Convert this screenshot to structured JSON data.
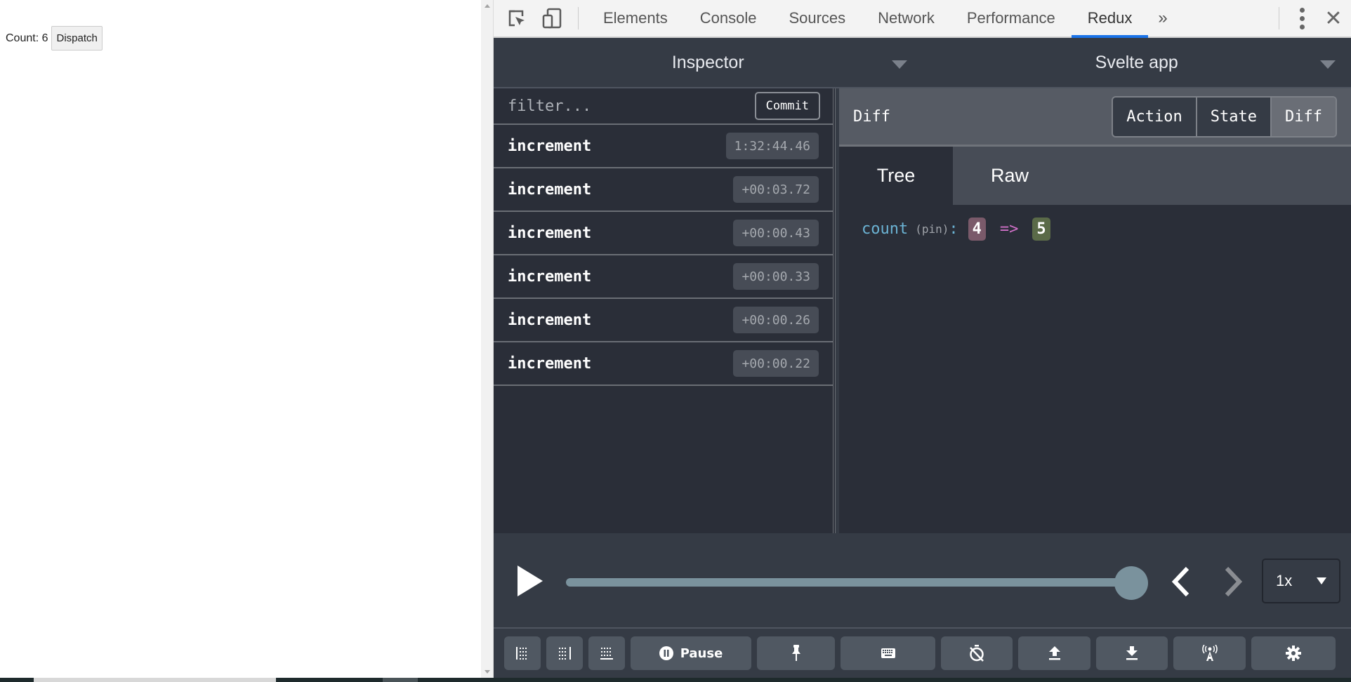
{
  "page": {
    "count_label": "Count: 6",
    "dispatch_label": "Dispatch"
  },
  "devtools": {
    "toolbar": {
      "inspect_icon": "inspect-element-icon",
      "device_icon": "device-toolbar-icon",
      "tabs": [
        {
          "label": "Elements",
          "active": false
        },
        {
          "label": "Console",
          "active": false
        },
        {
          "label": "Sources",
          "active": false
        },
        {
          "label": "Network",
          "active": false
        },
        {
          "label": "Performance",
          "active": false
        },
        {
          "label": "Redux",
          "active": true
        }
      ],
      "more_tabs": "»",
      "close": "✕"
    },
    "header": {
      "monitor": "Inspector",
      "instance": "Svelte app"
    },
    "list": {
      "filter_placeholder": "filter...",
      "filter_value": "",
      "commit_label": "Commit",
      "actions": [
        {
          "name": "increment",
          "time": "1:32:44.46"
        },
        {
          "name": "increment",
          "time": "+00:03.72"
        },
        {
          "name": "increment",
          "time": "+00:00.43"
        },
        {
          "name": "increment",
          "time": "+00:00.33"
        },
        {
          "name": "increment",
          "time": "+00:00.26"
        },
        {
          "name": "increment",
          "time": "+00:00.22"
        }
      ]
    },
    "detail": {
      "title": "Diff",
      "tabs": [
        {
          "label": "Action",
          "active": false
        },
        {
          "label": "State",
          "active": false
        },
        {
          "label": "Diff",
          "active": true
        }
      ],
      "subtabs": [
        {
          "label": "Tree",
          "active": true
        },
        {
          "label": "Raw",
          "active": false
        }
      ],
      "diff": {
        "key": "count",
        "pin": "(pin)",
        "colon": ":",
        "old": "4",
        "arrow": "=>",
        "new": "5"
      }
    },
    "slider": {
      "position_fraction": 1.0,
      "speed": "1x"
    },
    "bottom_buttons": [
      {
        "icon": "dock-left-icon",
        "label": ""
      },
      {
        "icon": "dock-right-icon",
        "label": ""
      },
      {
        "icon": "dock-bottom-icon",
        "label": ""
      },
      {
        "icon": "pause-icon",
        "label": "Pause"
      },
      {
        "icon": "pin-icon",
        "label": ""
      },
      {
        "icon": "keyboard-icon",
        "label": ""
      },
      {
        "icon": "timer-off-icon",
        "label": ""
      },
      {
        "icon": "upload-icon",
        "label": ""
      },
      {
        "icon": "download-icon",
        "label": ""
      },
      {
        "icon": "remote-icon",
        "label": ""
      },
      {
        "icon": "settings-icon",
        "label": ""
      }
    ]
  }
}
